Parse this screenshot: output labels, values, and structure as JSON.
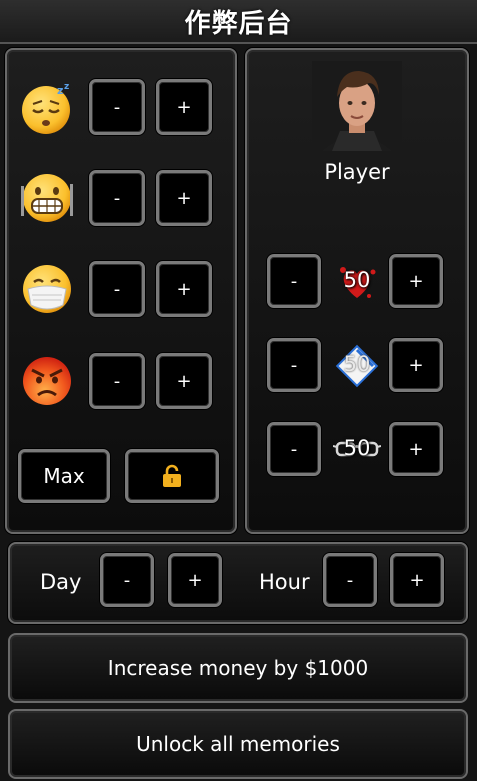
{
  "title": "作弊后台",
  "status_rows": [
    {
      "icon": "sleepy-face-icon",
      "minus": "-",
      "plus": "+"
    },
    {
      "icon": "hungry-face-icon",
      "minus": "-",
      "plus": "+"
    },
    {
      "icon": "sick-mask-face-icon",
      "minus": "-",
      "plus": "+"
    },
    {
      "icon": "angry-face-icon",
      "minus": "-",
      "plus": "+"
    }
  ],
  "max_label": "Max",
  "lock_icon": "padlock-icon",
  "player": {
    "name": "Player",
    "stats": [
      {
        "icon": "heart-stat-icon",
        "value": "50",
        "minus": "-",
        "plus": "+"
      },
      {
        "icon": "diamond-stat-icon",
        "value": "50",
        "minus": "-",
        "plus": "+"
      },
      {
        "icon": "glasses-stat-icon",
        "value": "50",
        "minus": "-",
        "plus": "+"
      }
    ]
  },
  "time": {
    "day_label": "Day",
    "hour_label": "Hour",
    "minus": "-",
    "plus": "+"
  },
  "actions": {
    "money": "Increase money by $1000",
    "memories": "Unlock all memories"
  },
  "colors": {
    "lock": "#f2b01e",
    "heart": "#d11a1a",
    "panel_border": "#6a6a6a"
  }
}
